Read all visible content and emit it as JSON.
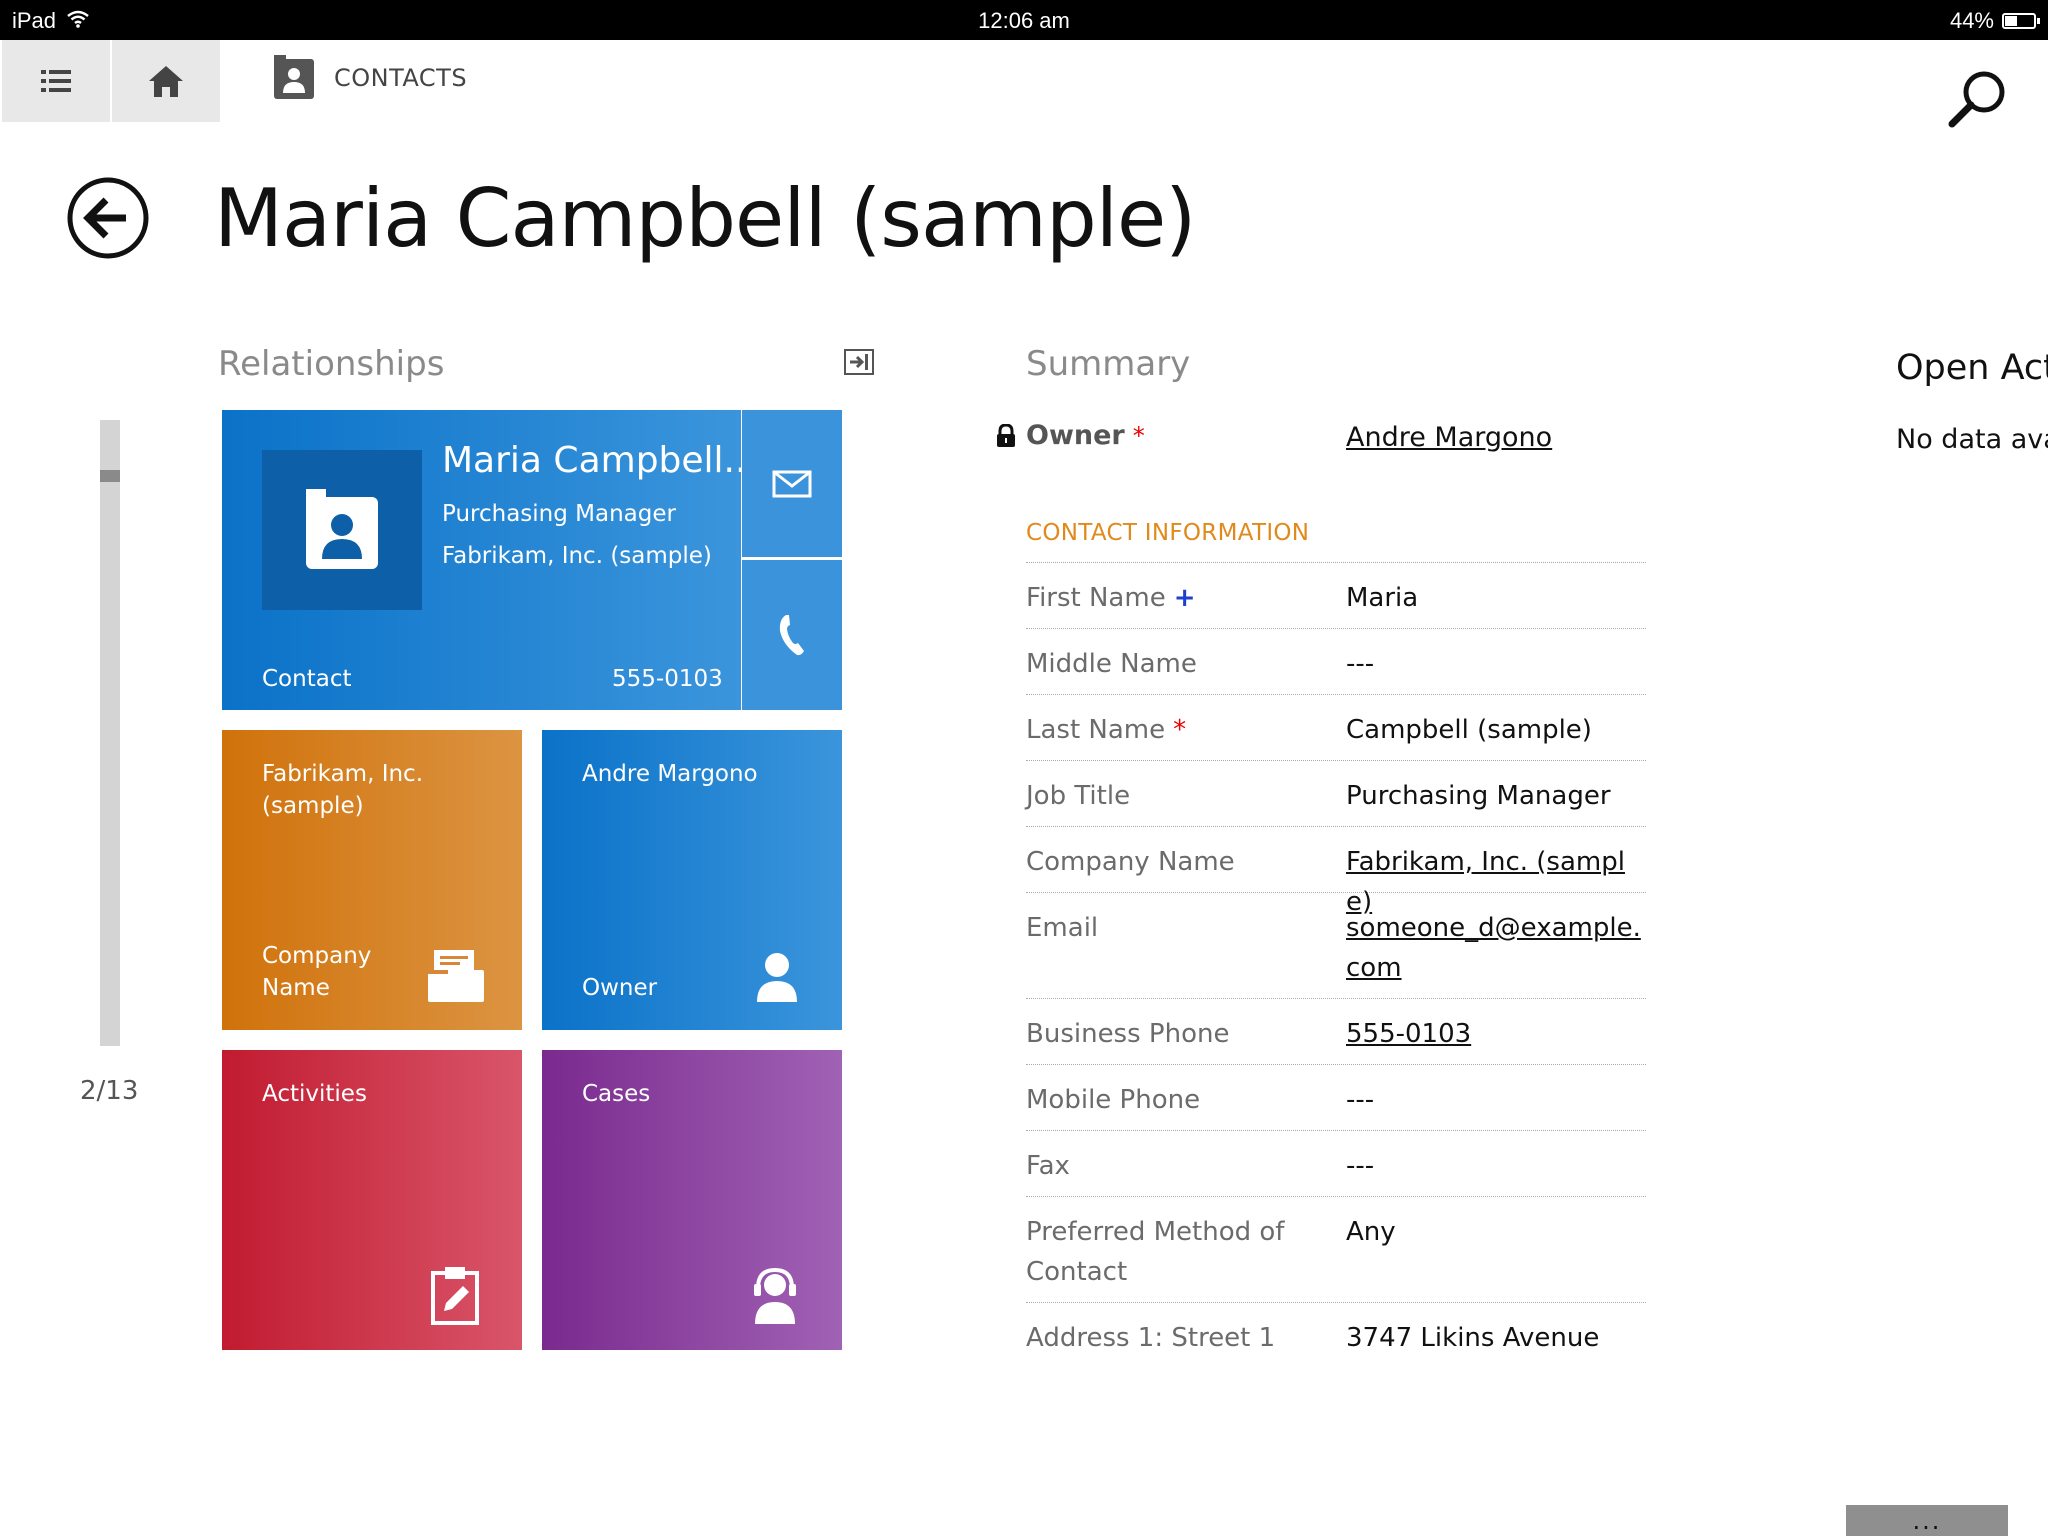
{
  "status_bar": {
    "device": "iPad",
    "time": "12:06 am",
    "battery_label": "44%",
    "battery_level": 0.44
  },
  "nav": {
    "section_label": "CONTACTS"
  },
  "page": {
    "title": "Maria Campbell (sample)"
  },
  "relationships": {
    "heading": "Relationships",
    "pager": "2/13",
    "contact_tile": {
      "name": "Maria Campbell...",
      "job_title": "Purchasing Manager",
      "company": "Fabrikam, Inc. (sample)",
      "type": "Contact",
      "phone": "555-0103"
    },
    "company_tile": {
      "name": "Fabrikam, Inc. (sample)",
      "caption": "Company Name"
    },
    "owner_tile": {
      "name": "Andre Margono",
      "caption": "Owner"
    },
    "activities_tile": {
      "title": "Activities"
    },
    "cases_tile": {
      "title": "Cases"
    }
  },
  "summary": {
    "heading": "Summary",
    "owner_label": "Owner",
    "owner_required": "*",
    "owner_value": "Andre Margono",
    "contact_info_heading": "CONTACT INFORMATION",
    "fields": [
      {
        "label": "First Name",
        "marker": "+",
        "value": "Maria"
      },
      {
        "label": "Middle Name",
        "value": "---"
      },
      {
        "label": "Last Name",
        "marker": "*",
        "value": "Campbell (sample)"
      },
      {
        "label": "Job Title",
        "value": "Purchasing Manager"
      },
      {
        "label": "Company Name",
        "value": "Fabrikam, Inc. (sample)"
      },
      {
        "label": "Email",
        "value": "someone_d@example.com"
      },
      {
        "label": "Business Phone",
        "value": "555-0103"
      },
      {
        "label": "Mobile Phone",
        "value": "---"
      },
      {
        "label": "Fax",
        "value": "---"
      },
      {
        "label": "Preferred Method of Contact",
        "value": "Any"
      },
      {
        "label": "Address 1: Street 1",
        "value": "3747 Likins Avenue"
      }
    ]
  },
  "open_activities": {
    "heading": "Open Act",
    "empty_text": "No data avai"
  },
  "command_bar": {
    "more_label": "..."
  }
}
